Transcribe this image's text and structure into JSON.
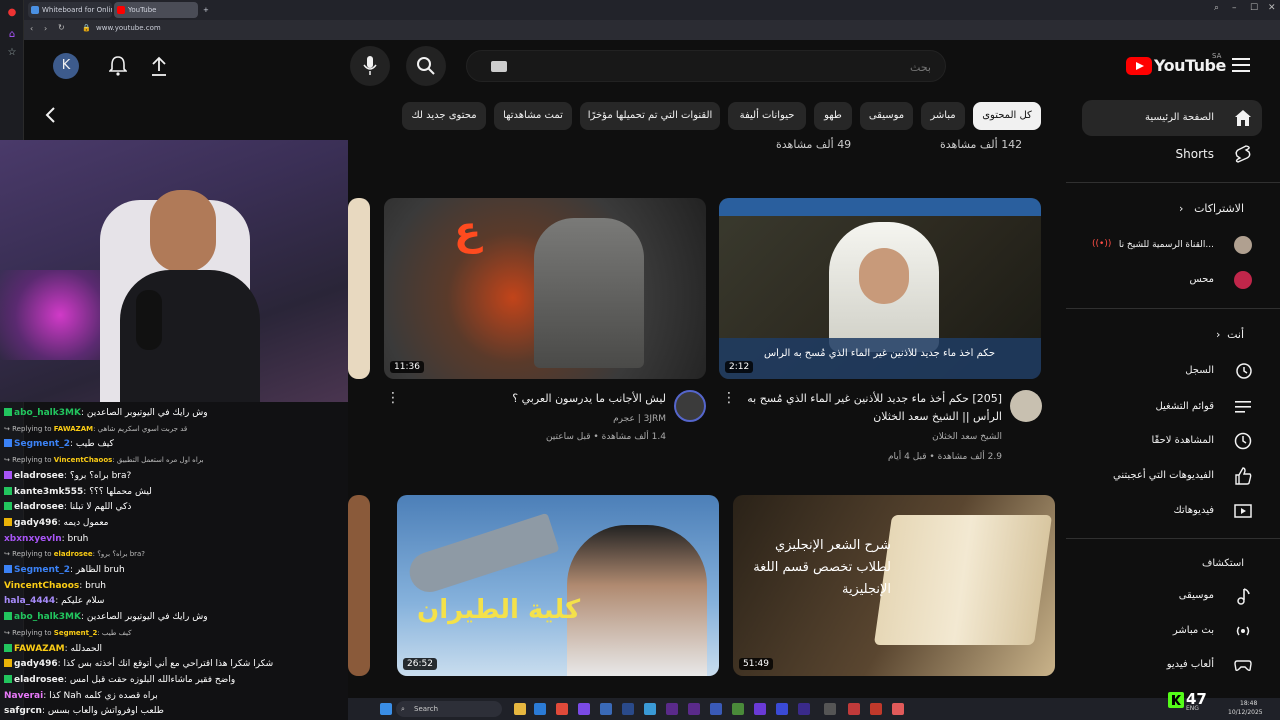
{
  "browser": {
    "tabs": [
      {
        "label": "Whiteboard for Online Co"
      },
      {
        "label": "YouTube"
      }
    ],
    "url": "www.youtube.com"
  },
  "youtube": {
    "logo_text": "YouTube",
    "region": "SA",
    "avatar_letter": "K",
    "search_placeholder": "بحث",
    "chips": [
      "كل المحتوى",
      "مباشر",
      "موسيقى",
      "طهو",
      "حيوانات أليفة",
      "القنوات التي تم تحميلها مؤخرًا",
      "تمت مشاهدتها",
      "محتوى جديد لك"
    ],
    "prev_views": [
      "142 ألف مشاهدة",
      "49 ألف مشاهدة"
    ],
    "guide": {
      "home": "الصفحة الرئيسية",
      "shorts": "Shorts",
      "subscriptions_header": "الاشتراكات",
      "subscriptions": [
        "القناة الرسمية للشيخ نا...",
        "محس"
      ],
      "you_header": "أنت",
      "you_items": [
        "السجل",
        "قوائم التشغيل",
        "المشاهدة لاحقًا",
        "الفيديوهات التي أعجبتني",
        "فيديوهاتك"
      ],
      "explore_header": "استكشاف",
      "explore_items": [
        "موسيقى",
        "بث مباشر",
        "ألعاب فيديو"
      ]
    },
    "videos": [
      {
        "title": "[205] حكم أخذ ماء جديد للأذنين غير الماء الذي مُسح به الرأس || الشيخ سعد الخثلان",
        "thumb_caption": "حكم أخذ ماء جديد للأذنين غير الماء الذي مُسح به الرأس",
        "channel": "الشيخ سعد الخثلان",
        "meta": "2.9 ألف مشاهدة • قبل 4 أيام",
        "duration": "2:12"
      },
      {
        "title": "ليش الأجانب ما يدرسون العربي ؟",
        "thumb_caption": "ع",
        "channel": "3JRM | عجرم",
        "meta": "1.4 ألف مشاهدة • قبل ساعتين",
        "duration": "11:36"
      },
      {
        "title": "",
        "thumb_caption": "شرح الشعر الإنجليزي لطلاب تخصص قسم اللغة الإنجليزية",
        "duration": "51:49"
      },
      {
        "title": "",
        "thumb_caption": "كلية الطيران",
        "duration": "26:52"
      }
    ]
  },
  "chat": [
    {
      "type": "msg",
      "user": "abo_halk3MK",
      "color": "#22c55e",
      "badge": "#22c55e",
      "text": "وش رايك في اليوتيوبر الصاعدين"
    },
    {
      "type": "reply",
      "to": "FAWAZAM",
      "text": "قد جربت اسوي اسكريم شاهي"
    },
    {
      "type": "msg",
      "user": "Segment_2",
      "color": "#3b82f6",
      "badge": "#3b82f6",
      "text": "كيف طيب"
    },
    {
      "type": "reply",
      "to": "VincentChaoos",
      "text": "براه اول مره استعمل التطبيق"
    },
    {
      "type": "msg",
      "user": "eladrosee",
      "color": "#f0f0f0",
      "badge": "#a855f7",
      "text": "براه؟ برو؟ bra?"
    },
    {
      "type": "msg",
      "user": "kante3mk555",
      "color": "#f0f0f0",
      "badge": "#22c55e",
      "text": "ليش محملها ؟؟؟"
    },
    {
      "type": "msg",
      "user": "eladrosee",
      "color": "#f0f0f0",
      "badge": "#22c55e",
      "text": "ذكي اللهم لا تبلنا"
    },
    {
      "type": "msg",
      "user": "gady496",
      "color": "#f0f0f0",
      "badge": "#eab308",
      "text": "معمول ديمه"
    },
    {
      "type": "msg",
      "user": "xbxnxyevln",
      "color": "#a855f7",
      "badge": "",
      "text": "bruh"
    },
    {
      "type": "reply",
      "to": "eladrosee",
      "text": "براه؟ برو؟ bra?"
    },
    {
      "type": "msg",
      "user": "Segment_2",
      "color": "#3b82f6",
      "badge": "#3b82f6",
      "text": "الظاهر bruh"
    },
    {
      "type": "msg",
      "user": "VincentChaoos",
      "color": "#facc15",
      "badge": "",
      "text": "bruh"
    },
    {
      "type": "msg",
      "user": "hala_4444",
      "color": "#a78bfa",
      "badge": "",
      "text": "سلام عليكم"
    },
    {
      "type": "msg",
      "user": "abo_halk3MK",
      "color": "#22c55e",
      "badge": "#22c55e",
      "text": "وش رايك في اليوتيوبر الصاعدين"
    },
    {
      "type": "reply",
      "to": "Segment_2",
      "text": "كيف طيب"
    },
    {
      "type": "msg",
      "user": "FAWAZAM",
      "color": "#facc15",
      "badge": "#22c55e",
      "text": "الحمدلله"
    },
    {
      "type": "msg",
      "user": "gady496",
      "color": "#f0f0f0",
      "badge": "#eab308",
      "text": "شكرا شكرا هذا اقتراحي مع أني أتوقع انك أخذته بس كذا"
    },
    {
      "type": "msg",
      "user": "eladrosee",
      "color": "#f0f0f0",
      "badge": "#22c55e",
      "text": "واضح فقير ماشاءالله البلوزه حقت قبل امس"
    },
    {
      "type": "msg",
      "user": "Naverai",
      "color": "#e879f9",
      "badge": "",
      "text": "كذا Nah براه قصده زي كلمه"
    },
    {
      "type": "msg",
      "user": "safgrcn",
      "color": "#f0f0f0",
      "badge": "",
      "text": "طلعب اوفرواتش والعاب بسس"
    }
  ],
  "taskbar": {
    "search_label": "Search",
    "time": "18:48",
    "date": "10/12/2025",
    "lang": "ENG"
  },
  "stream": {
    "viewers": "47"
  }
}
